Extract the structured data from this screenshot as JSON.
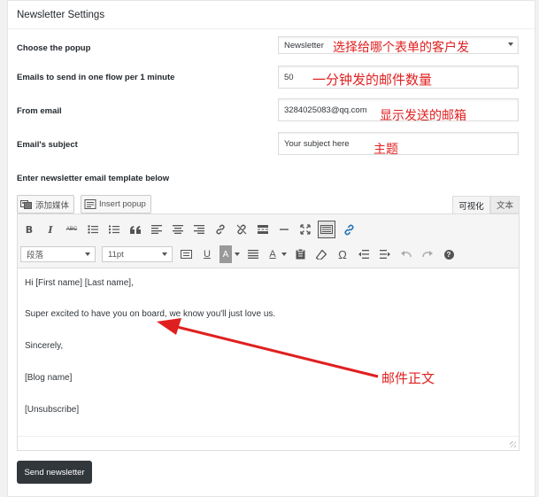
{
  "panel": {
    "title": "Newsletter Settings"
  },
  "fields": {
    "popup": {
      "label": "Choose the popup",
      "value": "Newsletter"
    },
    "rate": {
      "label": "Emails to send in one flow per 1 minute",
      "value": "50"
    },
    "from": {
      "label": "From email",
      "value": "3284025083@qq.com"
    },
    "subject": {
      "label": "Email's subject",
      "value": "Your subject here"
    },
    "template": {
      "label": "Enter newsletter email template below"
    }
  },
  "annotations": {
    "popup": "选择给哪个表单的客户发",
    "rate": "一分钟发的邮件数量",
    "from": "显示发送的邮箱",
    "subject": "主题",
    "body": "邮件正文",
    "arrow_color": "#e02020"
  },
  "editor": {
    "add_media": "添加媒体",
    "insert_popup": "Insert popup",
    "tab_visual": "可视化",
    "tab_text": "文本",
    "format_select": "段落",
    "size_select": "11pt",
    "toolbar_row1": [
      "bold-icon",
      "italic-icon",
      "strikethrough-icon",
      "bullet-list-icon",
      "numbered-list-icon",
      "blockquote-icon",
      "align-left-icon",
      "align-center-icon",
      "align-right-icon",
      "link-icon",
      "unlink-icon",
      "read-more-icon",
      "horizontal-rule-icon",
      "fullscreen-icon",
      "keyboard-toggle-icon",
      "link-color-icon"
    ],
    "toolbar_row2": [
      "text-direction-icon",
      "underline-icon",
      "background-color-icon",
      "justify-icon",
      "text-color-icon",
      "paste-text-icon",
      "clear-format-icon",
      "special-char-icon",
      "outdent-icon",
      "indent-icon",
      "undo-icon",
      "redo-icon",
      "help-icon"
    ],
    "body_lines": [
      "Hi [First name] [Last name],",
      "Super excited to have you on board, we know you'll just love us.",
      "Sincerely,",
      "[Blog name]",
      "[Unsubscribe]"
    ],
    "bold_glyph": "B",
    "italic_glyph": "I",
    "strike_glyph": "ABC",
    "underline_glyph": "U",
    "bgcolor_glyph": "A",
    "textcolor_glyph": "A",
    "omega_glyph": "Ω",
    "help_glyph": "?"
  },
  "actions": {
    "send": "Send newsletter"
  }
}
